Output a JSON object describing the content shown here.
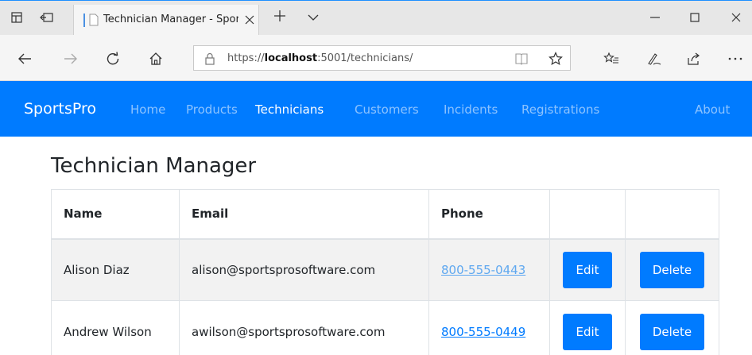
{
  "browser": {
    "tab_title": "Technician Manager - SportsPro",
    "url_prefix": "https://",
    "url_host": "localhost",
    "url_rest": ":5001/technicians/"
  },
  "navbar": {
    "brand": "SportsPro",
    "items": [
      {
        "label": "Home",
        "active": false
      },
      {
        "label": "Products",
        "active": false
      },
      {
        "label": "Technicians",
        "active": true
      },
      {
        "label": "Customers",
        "active": false
      },
      {
        "label": "Incidents",
        "active": false
      },
      {
        "label": "Registrations",
        "active": false
      }
    ],
    "about": "About"
  },
  "page": {
    "title": "Technician Manager"
  },
  "table": {
    "headers": [
      "Name",
      "Email",
      "Phone",
      "",
      ""
    ],
    "rows": [
      {
        "name": "Alison Diaz",
        "email": "alison@sportsprosoftware.com",
        "phone": "800-555-0443",
        "edit": "Edit",
        "delete": "Delete"
      },
      {
        "name": "Andrew Wilson",
        "email": "awilson@sportsprosoftware.com",
        "phone": "800-555-0449",
        "edit": "Edit",
        "delete": "Delete"
      }
    ]
  },
  "colors": {
    "primary": "#007bff",
    "nav_inactive": "rgba(255,255,255,0.55)",
    "stripe": "#f2f2f2"
  }
}
